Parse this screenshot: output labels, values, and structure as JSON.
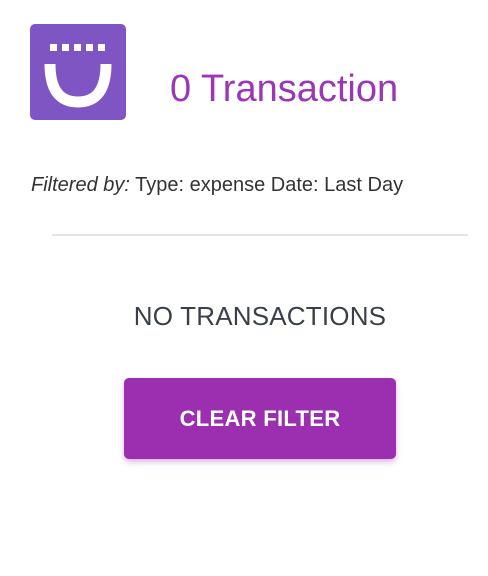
{
  "header": {
    "logo_icon": "smile-app-icon",
    "title": "0 Transaction"
  },
  "filter": {
    "prefix": "Filtered by:",
    "text": " Type: expense Date: Last Day"
  },
  "empty_state": {
    "message": "NO TRANSACTIONS"
  },
  "actions": {
    "clear_filter_label": "CLEAR FILTER"
  },
  "colors": {
    "brand_purple": "#9b2fb0",
    "logo_purple": "#7e55c2",
    "title_purple": "#9b36b7",
    "text_dark": "#333333"
  }
}
